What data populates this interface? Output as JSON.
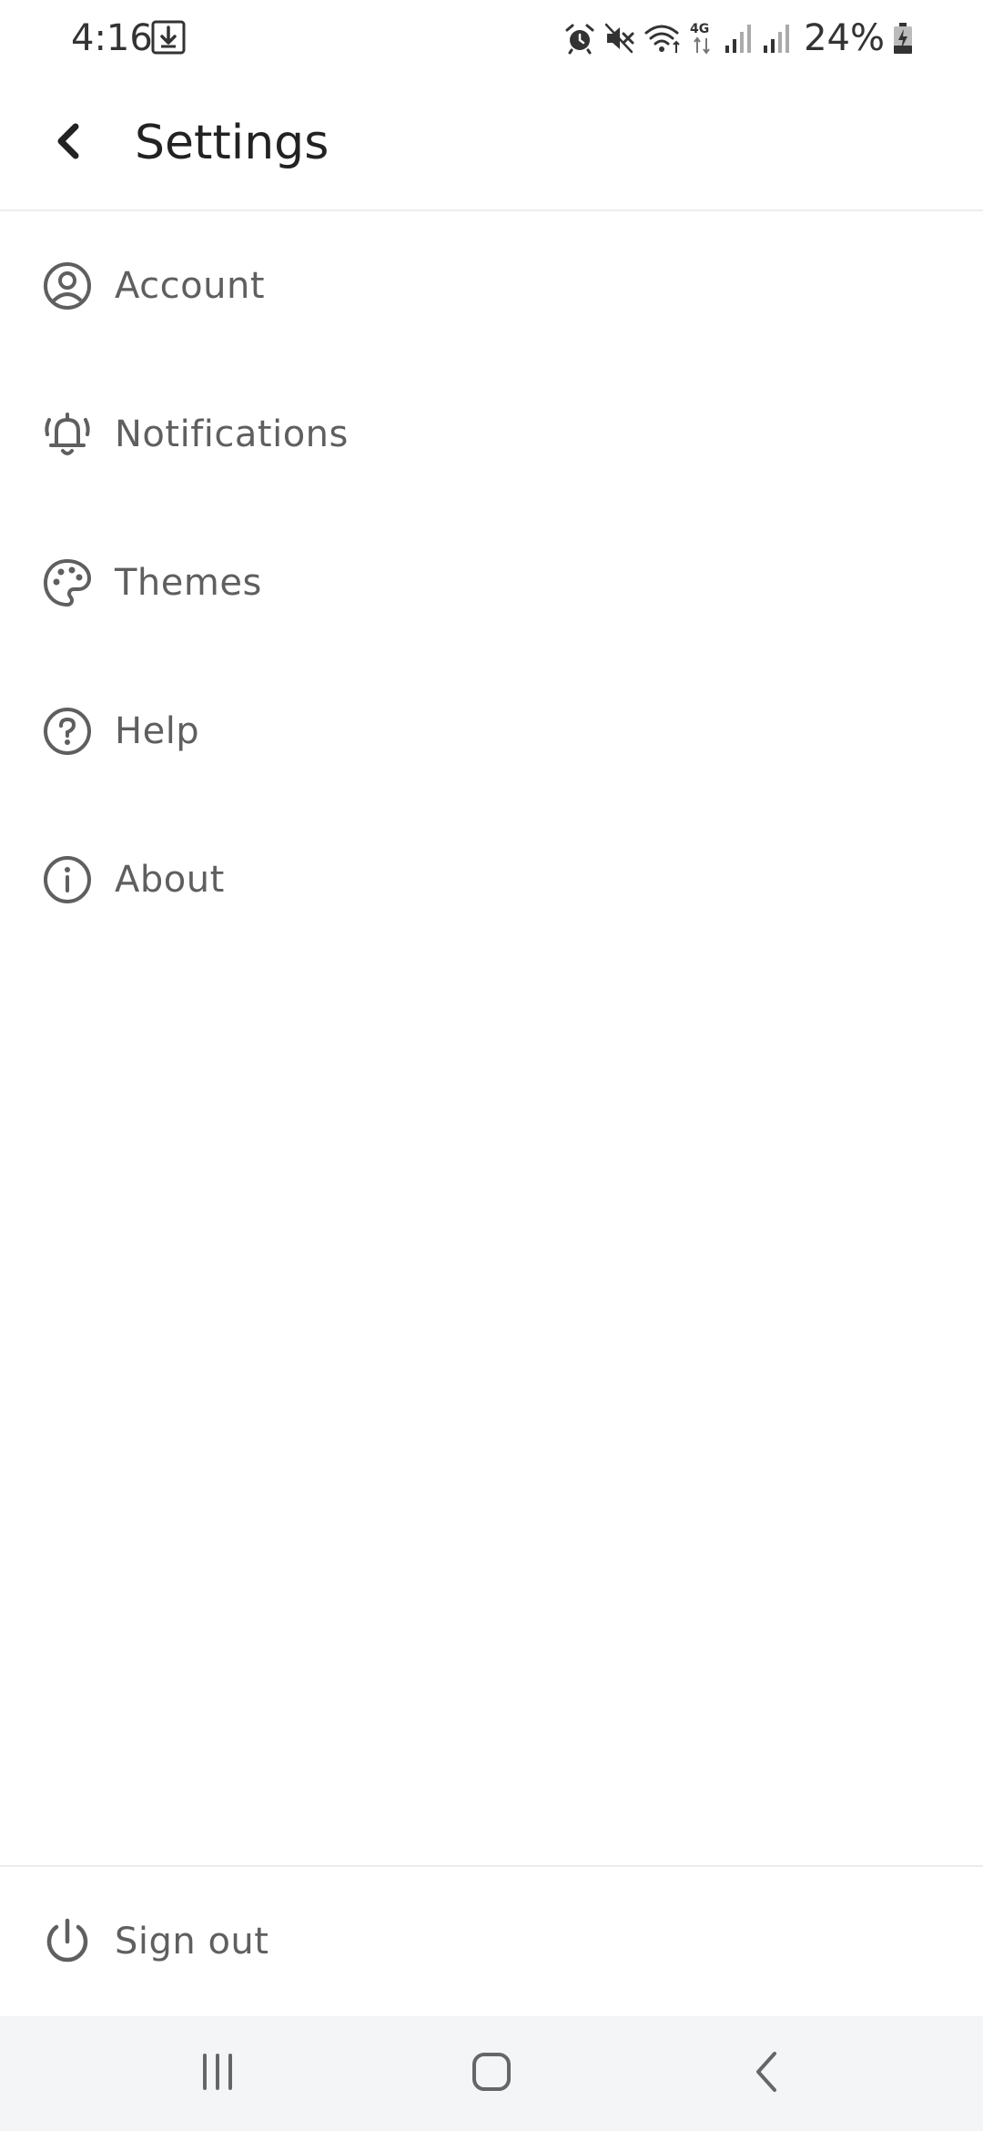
{
  "status_bar": {
    "time": "4:16",
    "battery": "24%",
    "network": "4G",
    "icons": [
      "download-icon",
      "alarm-icon",
      "mute-icon",
      "wifi-icon",
      "network-4g-icon",
      "signal-icon",
      "signal-icon",
      "battery-charging-icon"
    ]
  },
  "app_bar": {
    "title": "Settings",
    "back_icon": "chevron-left-icon"
  },
  "menu": {
    "items": [
      {
        "label": "Account",
        "icon": "account-circle-icon"
      },
      {
        "label": "Notifications",
        "icon": "bell-ringing-icon"
      },
      {
        "label": "Themes",
        "icon": "palette-icon"
      },
      {
        "label": "Help",
        "icon": "help-circle-icon"
      },
      {
        "label": "About",
        "icon": "info-circle-icon"
      }
    ]
  },
  "footer": {
    "sign_out_label": "Sign out",
    "sign_out_icon": "power-icon"
  },
  "nav_bar": {
    "buttons": [
      "recents-icon",
      "home-icon",
      "back-icon"
    ]
  },
  "colors": {
    "text_primary": "#222222",
    "text_secondary": "#5f5f5f",
    "divider": "#ececec",
    "nav_background": "#f4f5f7"
  }
}
